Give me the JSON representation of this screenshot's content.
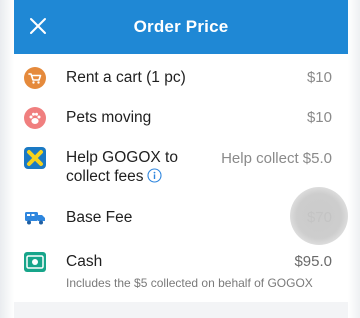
{
  "header": {
    "title": "Order Price",
    "close_icon": "close-icon"
  },
  "items": [
    {
      "icon": "cart-icon",
      "label": "Rent a cart (1 pc)",
      "price": "$10"
    },
    {
      "icon": "paw-icon",
      "label": "Pets moving",
      "price": "$10"
    },
    {
      "icon": "gogox-icon",
      "label_line1": "Help GOGOX to",
      "label_line2": "collect fees",
      "info_icon": "info-icon",
      "price": "Help collect $5.0"
    },
    {
      "icon": "truck-icon",
      "label": "Base Fee",
      "price": "$70"
    },
    {
      "icon": "cash-icon",
      "label": "Cash",
      "price": "$95.0",
      "note": "Includes the $5 collected on behalf of GOGOX"
    }
  ],
  "colors": {
    "header_bg": "#1f88d5",
    "cart_icon": "#e58a3c",
    "paw_icon": "#f07f7f",
    "gogox_icon_bg": "#1a79c4",
    "gogox_icon_fg": "#f5d21d",
    "truck_icon": "#2e86de",
    "cash_icon": "#17a58a"
  }
}
